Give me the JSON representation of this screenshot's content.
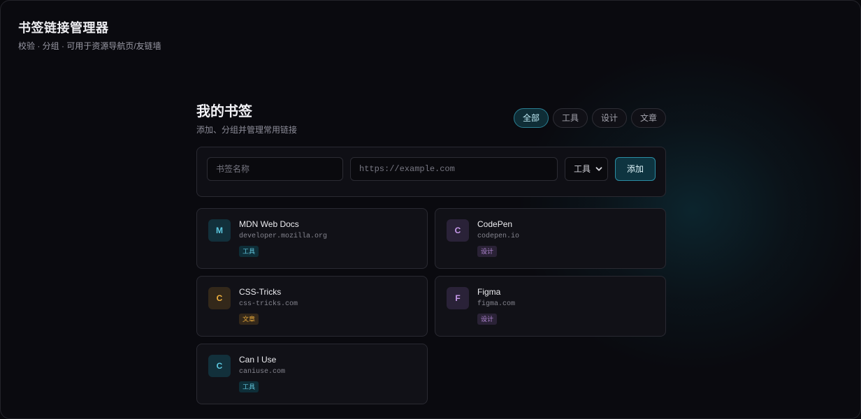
{
  "app": {
    "title": "书签链接管理器",
    "subtitle": "校验 · 分组 · 可用于资源导航页/友链墙"
  },
  "panel": {
    "title": "我的书签",
    "subtitle": "添加、分组并管理常用链接"
  },
  "filters": [
    {
      "label": "全部",
      "active": true
    },
    {
      "label": "工具",
      "active": false
    },
    {
      "label": "设计",
      "active": false
    },
    {
      "label": "文章",
      "active": false
    }
  ],
  "form": {
    "name_placeholder": "书签名称",
    "name_value": "",
    "url_placeholder": "https://example.com",
    "url_value": "",
    "category_selected": "工具",
    "add_label": "添加"
  },
  "bookmarks": [
    {
      "initial": "M",
      "name": "MDN Web Docs",
      "domain": "developer.mozilla.org",
      "tag": "工具",
      "category": "tool"
    },
    {
      "initial": "C",
      "name": "CodePen",
      "domain": "codepen.io",
      "tag": "设计",
      "category": "design"
    },
    {
      "initial": "C",
      "name": "CSS-Tricks",
      "domain": "css-tricks.com",
      "tag": "文章",
      "category": "article"
    },
    {
      "initial": "F",
      "name": "Figma",
      "domain": "figma.com",
      "tag": "设计",
      "category": "design"
    },
    {
      "initial": "C",
      "name": "Can I Use",
      "domain": "caniuse.com",
      "tag": "工具",
      "category": "tool"
    }
  ],
  "colors": {
    "accent": "#2b8ea4",
    "tool": "#5cc8e0",
    "design": "#c89aec",
    "article": "#f0b13e"
  }
}
